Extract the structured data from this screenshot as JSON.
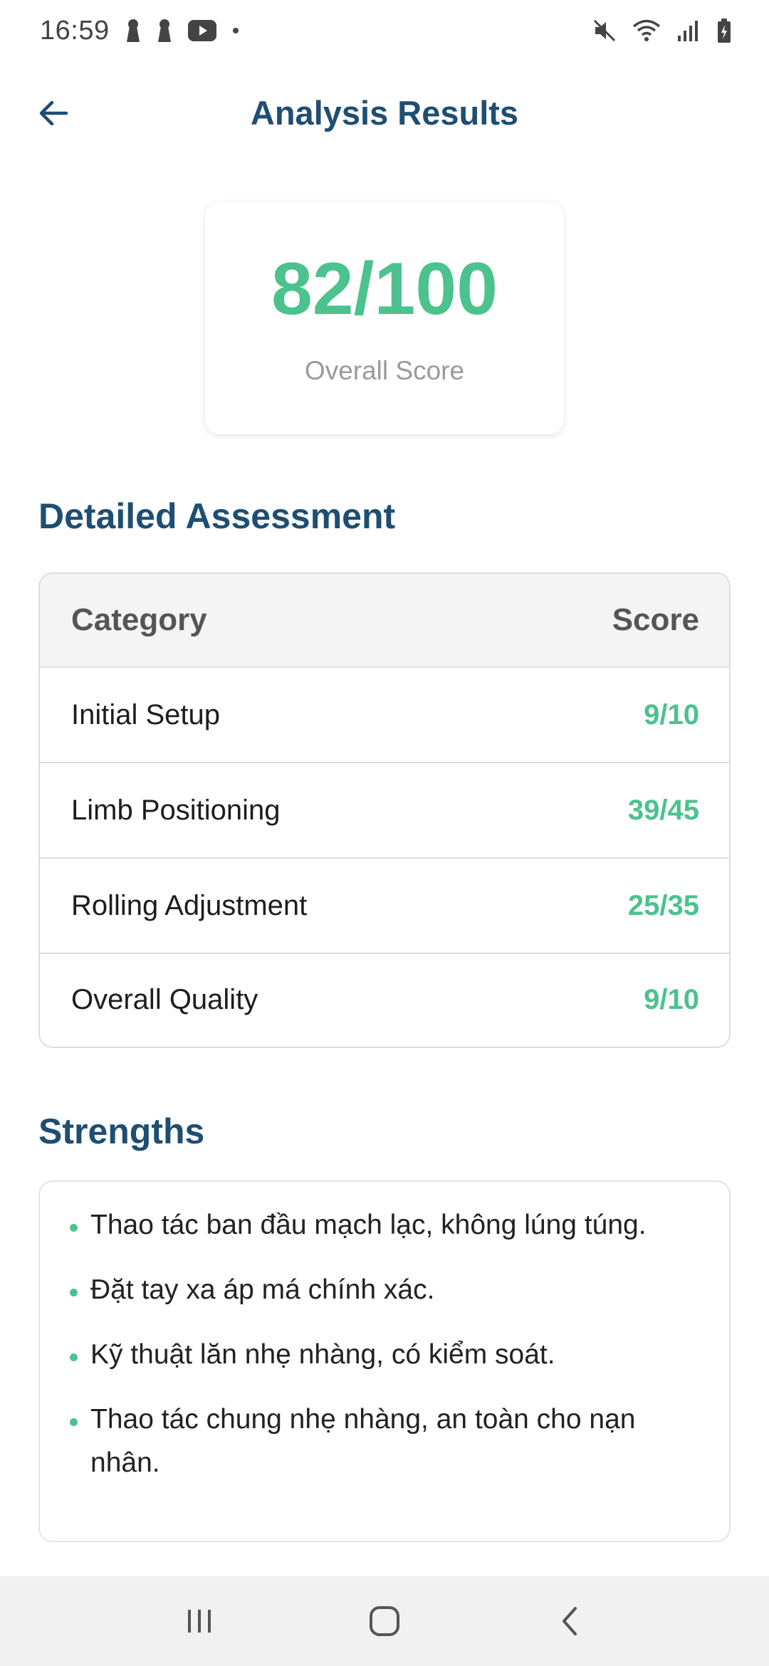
{
  "status_bar": {
    "time": "16:59",
    "left_icons": [
      "keyhole-icon",
      "keyhole-icon",
      "youtube-icon",
      "dot-icon"
    ],
    "right_icons": [
      "mute-icon",
      "wifi-icon",
      "signal-icon",
      "battery-icon"
    ]
  },
  "header": {
    "title": "Analysis Results",
    "back_icon": "arrow-left-icon"
  },
  "score": {
    "value": "82/100",
    "label": "Overall Score"
  },
  "assessment": {
    "heading": "Detailed Assessment",
    "columns": [
      "Category",
      "Score"
    ],
    "rows": [
      {
        "category": "Initial Setup",
        "score": "9/10"
      },
      {
        "category": "Limb Positioning",
        "score": "39/45"
      },
      {
        "category": "Rolling Adjustment",
        "score": "25/35"
      },
      {
        "category": "Overall Quality",
        "score": "9/10"
      }
    ]
  },
  "strengths": {
    "heading": "Strengths",
    "items": [
      "Thao tác ban đầu mạch lạc, không lúng túng.",
      "Đặt tay xa áp má chính xác.",
      "Kỹ thuật lăn nhẹ nhàng, có kiểm soát.",
      "Thao tác chung nhẹ nhàng, an toàn cho nạn nhân."
    ]
  },
  "nav_bar": {
    "buttons": [
      "recents-icon",
      "home-icon",
      "back-icon"
    ]
  },
  "colors": {
    "title": "#1e4e73",
    "accent_green": "#4cc28e",
    "muted": "#9a9a9a"
  }
}
